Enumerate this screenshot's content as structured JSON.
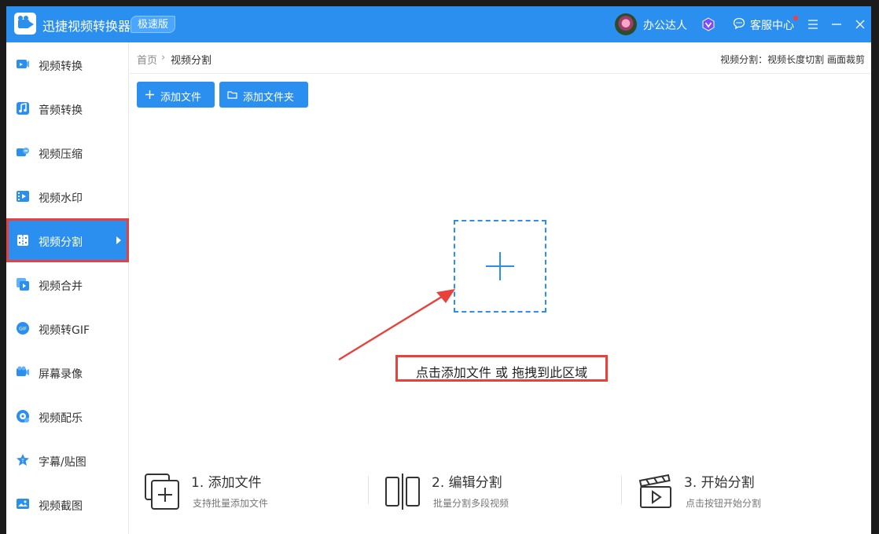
{
  "app": {
    "title": "迅捷视频转换器",
    "edition_badge": "极速版",
    "username": "办公达人",
    "customer_service": "客服中心"
  },
  "sidebar": {
    "items": [
      {
        "label": "视频转换",
        "icon": "video-convert-icon"
      },
      {
        "label": "音频转换",
        "icon": "audio-convert-icon"
      },
      {
        "label": "视频压缩",
        "icon": "video-compress-icon"
      },
      {
        "label": "视频水印",
        "icon": "video-watermark-icon"
      },
      {
        "label": "视频分割",
        "icon": "video-split-icon",
        "active": true
      },
      {
        "label": "视频合并",
        "icon": "video-merge-icon"
      },
      {
        "label": "视频转GIF",
        "icon": "video-to-gif-icon"
      },
      {
        "label": "屏幕录像",
        "icon": "screen-record-icon"
      },
      {
        "label": "视频配乐",
        "icon": "video-music-icon"
      },
      {
        "label": "字幕/贴图",
        "icon": "subtitle-sticker-icon"
      },
      {
        "label": "视频截图",
        "icon": "video-screenshot-icon"
      }
    ]
  },
  "breadcrumb": {
    "home": "首页",
    "separator": "›",
    "current": "视频分割",
    "right_info": "视频分割：视频长度切割 画面裁剪"
  },
  "toolbar": {
    "add_file": "添加文件",
    "add_folder": "添加文件夹"
  },
  "dropzone": {
    "hint": "点击添加文件 或 拖拽到此区域"
  },
  "steps": [
    {
      "title": "1. 添加文件",
      "desc": "支持批量添加文件"
    },
    {
      "title": "2. 编辑分割",
      "desc": "批量分割多段视频"
    },
    {
      "title": "3. 开始分割",
      "desc": "点击按钮开始分割"
    }
  ],
  "colors": {
    "primary": "#2b8ff0",
    "highlight": "#e8403a"
  }
}
